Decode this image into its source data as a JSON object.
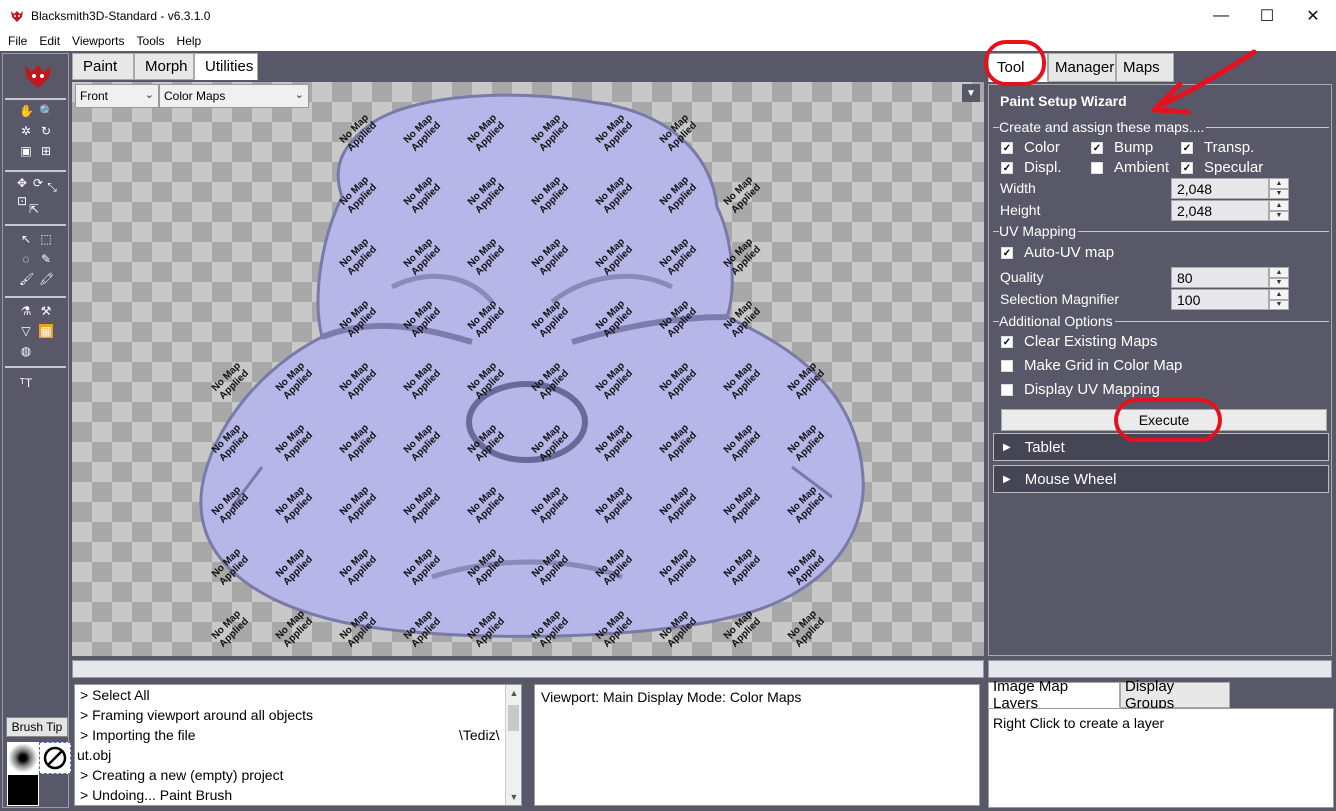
{
  "window": {
    "title": "Blacksmith3D-Standard - v6.3.1.0",
    "controls": {
      "minimize": "—",
      "maximize": "☐",
      "close": "✕"
    }
  },
  "menu": [
    "File",
    "Edit",
    "Viewports",
    "Tools",
    "Help"
  ],
  "viewport_tabs": {
    "paint": "Paint",
    "morph": "Morph",
    "utilities": "Utilities",
    "active": "Utilities"
  },
  "viewport": {
    "view_select": "Front",
    "display_select": "Color Maps",
    "mesh_label_line1": "No Map",
    "mesh_label_line2": "Applied",
    "mesh_color": "#b6b6e8"
  },
  "toolbox": {
    "brush_tip_label": "Brush Tip",
    "logo_color": "#c0181c"
  },
  "log": {
    "lines": [
      "> Select All",
      "> Framing viewport around all objects",
      "> Importing the file",
      "\\Tediz\\",
      "ut.obj",
      "> Creating a new (empty) project",
      "> Undoing... Paint Brush"
    ]
  },
  "info_panel": {
    "text": "Viewport: Main Display Mode: Color Maps"
  },
  "right_panel": {
    "tabs": [
      "Tool",
      "Manager",
      "Maps"
    ],
    "active_tab": "Tool",
    "wizard_title": "Paint Setup Wizard",
    "maps_group": {
      "label": "Create and assign these maps....",
      "color": {
        "label": "Color",
        "checked": true
      },
      "bump": {
        "label": "Bump",
        "checked": true
      },
      "transp": {
        "label": "Transp.",
        "checked": true
      },
      "displ": {
        "label": "Displ.",
        "checked": true
      },
      "ambient": {
        "label": "Ambient",
        "checked": false
      },
      "specular": {
        "label": "Specular",
        "checked": true
      },
      "width_label": "Width",
      "width_value": "2,048",
      "height_label": "Height",
      "height_value": "2,048"
    },
    "uv_group": {
      "label": "UV Mapping",
      "auto_uv": {
        "label": "Auto-UV map",
        "checked": true
      },
      "quality_label": "Quality",
      "quality_value": "80",
      "magnifier_label": "Selection Magnifier",
      "magnifier_value": "100"
    },
    "options_group": {
      "label": "Additional Options",
      "clear": {
        "label": "Clear Existing Maps",
        "checked": true
      },
      "grid": {
        "label": "Make Grid in Color Map",
        "checked": false
      },
      "display_uv": {
        "label": "Display UV Mapping",
        "checked": false
      }
    },
    "execute_label": "Execute",
    "tablet_label": "Tablet",
    "mouse_wheel_label": "Mouse Wheel"
  },
  "layers": {
    "tabs": [
      "Image Map Layers",
      "Display Groups"
    ],
    "active_tab": "Image Map Layers",
    "hint": "Right Click to create a layer"
  },
  "annotation_color": "#e8101c"
}
